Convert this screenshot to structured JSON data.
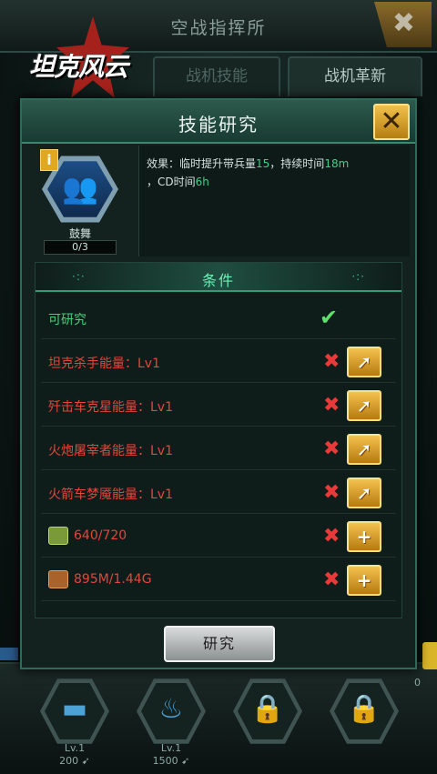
{
  "top": {
    "title": "空战指挥所",
    "close_glyph": "✖"
  },
  "logo": {
    "text": "坦克风云"
  },
  "tabs": [
    {
      "label": "战机技能"
    },
    {
      "label": "战机革新"
    }
  ],
  "dialog": {
    "title": "技能研究",
    "close_glyph": "✕",
    "skill": {
      "name": "鼓舞",
      "count": "0/3",
      "info_glyph": "i",
      "icon": "people-icon"
    },
    "effect": {
      "prefix": "效果：临时提升带兵量",
      "troops": "15",
      "mid": "，持续时间",
      "duration": "18m",
      "cd_prefix": "，CD时间",
      "cd": "6h"
    },
    "conditions": {
      "title": "条件",
      "dots_left": "·:·",
      "dots_right": "·:·",
      "researchable": {
        "label": "可研究",
        "check": "✔"
      },
      "requirements": [
        {
          "label": "坦克杀手能量：Lv1",
          "x": "✖",
          "btn": "➚"
        },
        {
          "label": "歼击车克星能量：Lv1",
          "x": "✖",
          "btn": "➚"
        },
        {
          "label": "火炮屠宰者能量：Lv1",
          "x": "✖",
          "btn": "➚"
        },
        {
          "label": "火箭车梦魇能量：Lv1",
          "x": "✖",
          "btn": "➚"
        }
      ],
      "resources": [
        {
          "label": "640/720",
          "x": "✖",
          "btn": "+",
          "icon": "dice-icon"
        },
        {
          "label": "895M/1.44G",
          "x": "✖",
          "btn": "+",
          "icon": "fuel-icon"
        }
      ]
    },
    "research_button": "研究"
  },
  "units": [
    {
      "level": "Lv.1",
      "cost": "200 ➹",
      "glyph": "▬"
    },
    {
      "level": "Lv.1",
      "cost": "1500 ➹",
      "glyph": "♨"
    },
    {
      "level": "",
      "cost": "",
      "glyph": "🔒"
    },
    {
      "level": "",
      "cost": "",
      "glyph": "🔒"
    }
  ],
  "side": {
    "zero": "0"
  },
  "colors": {
    "accent_green": "#3fd08a",
    "error_red": "#e3463a",
    "gold": "#f4c24e"
  }
}
